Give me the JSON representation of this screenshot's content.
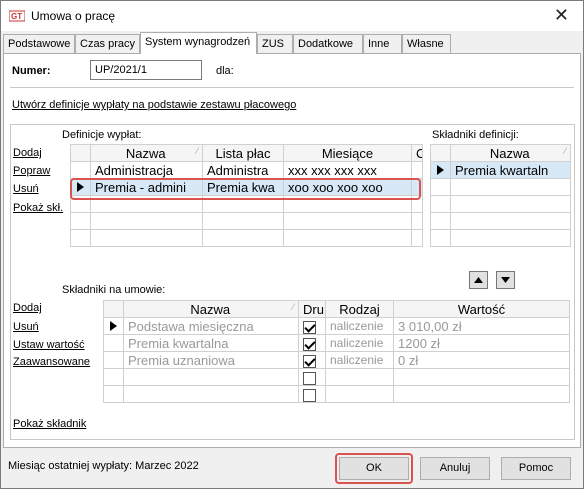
{
  "window": {
    "title": "Umowa o pracę",
    "close": "✕"
  },
  "tabs": [
    "Podstawowe",
    "Czas pracy",
    "System wynagrodzeń",
    "ZUS",
    "Dodatkowe",
    "Inne",
    "Własne"
  ],
  "form": {
    "numer_label": "Numer:",
    "numer_value": "UP/2021/1",
    "dla_label": "dla:"
  },
  "create_link": "Utwórz definicje wypłaty na podstawie zestawu płacowego",
  "definitions": {
    "title": "Definicje wypłat:",
    "actions": [
      "Dodaj",
      "Popraw",
      "Usuń",
      "Pokaż skł."
    ],
    "columns": [
      "Nazwa",
      "Lista płac",
      "Miesiące",
      "C"
    ],
    "rows": [
      {
        "nazwa": "Administracja",
        "lista": "Administra",
        "miesiace": "xxx xxx xxx xxx"
      },
      {
        "nazwa": "Premia - admini",
        "lista": "Premia kwa",
        "miesiace": "xoo xoo xoo xoo"
      }
    ]
  },
  "components_def": {
    "title": "Składniki definicji:",
    "column": "Nazwa",
    "rows": [
      "Premia kwartaln"
    ]
  },
  "contract": {
    "title": "Składniki na umowie:",
    "actions": [
      "Dodaj",
      "Usuń",
      "Ustaw wartość",
      "Zaawansowane"
    ],
    "show_link": "Pokaż składnik",
    "columns": [
      "Nazwa",
      "Dru",
      "Rodzaj",
      "Wartość"
    ],
    "rows": [
      {
        "nazwa": "Podstawa miesięczna",
        "dru": true,
        "rodzaj": "naliczenie",
        "wartosc": "3 010,00 zł"
      },
      {
        "nazwa": "Premia kwartalna",
        "dru": true,
        "rodzaj": "naliczenie",
        "wartosc": "1200 zł"
      },
      {
        "nazwa": "Premia uznaniowa",
        "dru": true,
        "rodzaj": "naliczenie",
        "wartosc": "0 zł"
      }
    ]
  },
  "footer": {
    "status": "Miesiąc ostatniej wypłaty: Marzec 2022",
    "ok": "OK",
    "cancel": "Anuluj",
    "help": "Pomoc"
  },
  "colors": {
    "highlight": "#d9534f",
    "selection": "#d7e9f7"
  }
}
